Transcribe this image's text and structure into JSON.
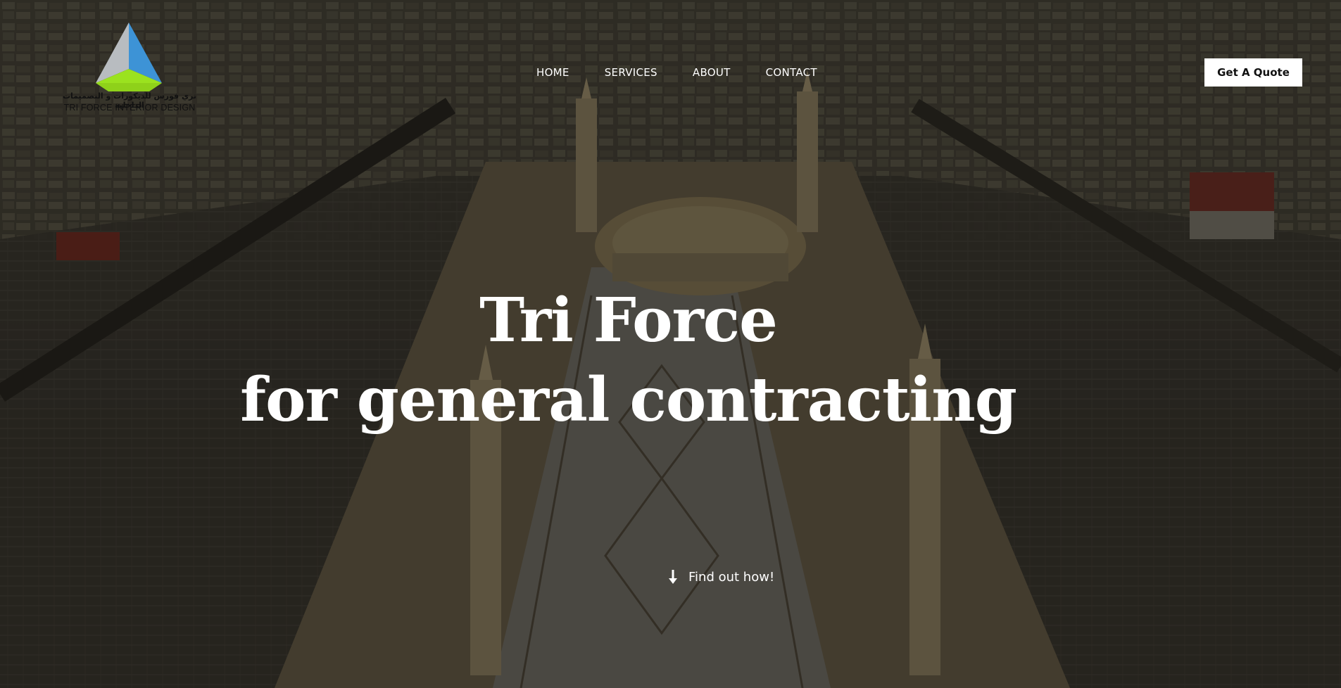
{
  "logo": {
    "arabic_text": "تري فورس للديكورات و التصميمات الداخلية",
    "english_text": "TRI FORCE INTERIOR DESIGN",
    "colors": [
      "#9aa0a6",
      "#3b8fd0",
      "#8fd11a"
    ]
  },
  "nav": {
    "items": [
      {
        "label": "HOME"
      },
      {
        "label": "SERVICES"
      },
      {
        "label": "ABOUT"
      },
      {
        "label": "CONTACT"
      }
    ]
  },
  "cta": {
    "label": "Get A Quote"
  },
  "hero": {
    "line1": "Tri Force",
    "line2": "for general contracting",
    "scroll_label": "Find out how!",
    "scroll_icon": "arrow-down-icon"
  },
  "theme": {
    "overlay": "#14120e",
    "text": "#ffffff",
    "button_bg": "#ffffff"
  }
}
